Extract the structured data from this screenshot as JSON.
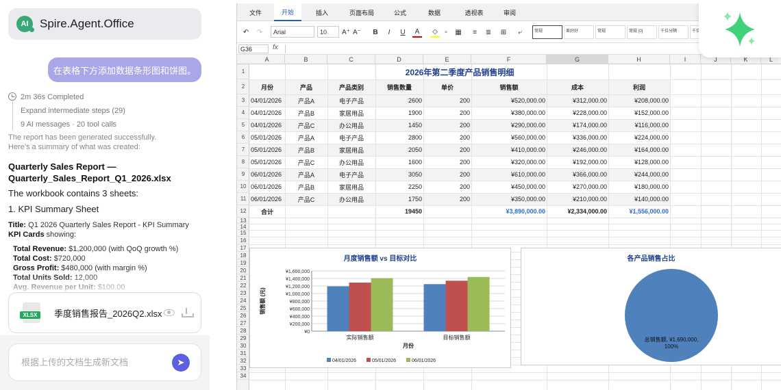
{
  "app": {
    "name": "Spire.Agent.Office",
    "logo_text": "AI"
  },
  "conversation": {
    "user_message": "在表格下方添加数据条形图和饼图。",
    "status": "2m 36s Completed",
    "steps": "Expand intermediate steps (29)",
    "messages": "9 AI messages · 20 tool calls",
    "summary_line1": "The report has been generated successfully.",
    "summary_line2": "Here's a summary of what was created:",
    "report_title": "Quarterly Sales Report — Quarterly_Sales_Report_Q1_2026.xlsx",
    "contains": "The workbook contains 3 sheets:",
    "sheet1": "1. KPI Summary Sheet",
    "title_label": "Title:",
    "title_value": "Q1 2026 Quarterly Sales Report - KPI Summary",
    "kpi_label": "KPI Cards",
    "kpi_suffix": "showing:",
    "kpis": [
      {
        "label": "Total Revenue:",
        "value": "$1,200,000 (with QoQ growth %)"
      },
      {
        "label": "Total Cost:",
        "value": "$720,000"
      },
      {
        "label": "Gross Profit:",
        "value": "$480,000 (with margin %)"
      },
      {
        "label": "Total Units Sold:",
        "value": "12,000"
      },
      {
        "label": "Avg. Revenue per Unit:",
        "value": "$100.00"
      }
    ]
  },
  "file": {
    "badge": "XLSX",
    "name": "季度销售报告_2026Q2.xlsx"
  },
  "input": {
    "placeholder": "根据上传的文档生成新文档"
  },
  "excel": {
    "menu_tabs": [
      "文件",
      "开始",
      "插入",
      "页面布局",
      "公式",
      "数据",
      "透视表",
      "审阅"
    ],
    "font": "Arial",
    "font_size": "10",
    "cell_ref": "G36",
    "fx": "fx",
    "styles": [
      "常规",
      "差好好",
      "常规",
      "常规 [0]",
      "千位分隔",
      "千位分隔"
    ],
    "columns": [
      "A",
      "B",
      "C",
      "D",
      "E",
      "F",
      "G",
      "H",
      "I",
      "J",
      "K",
      "L"
    ],
    "rows": [
      "1",
      "2",
      "3",
      "4",
      "5",
      "6",
      "7",
      "8",
      "9",
      "10",
      "11",
      "12",
      "13",
      "14",
      "15",
      "16",
      "17",
      "18",
      "19",
      "20",
      "21",
      "22",
      "23",
      "24",
      "25",
      "26",
      "27",
      "28",
      "29",
      "30",
      "31",
      "32",
      "33",
      "34"
    ],
    "table_title": "2026年第二季度产品销售明细",
    "headers": [
      "月份",
      "产品",
      "产品类别",
      "销售数量",
      "单价",
      "销售额",
      "成本",
      "利润"
    ],
    "data_rows": [
      [
        "04/01/2026",
        "产品A",
        "电子产品",
        "2600",
        "200",
        "¥520,000.00",
        "¥312,000.00",
        "¥208,000.00"
      ],
      [
        "04/01/2026",
        "产品B",
        "家居用品",
        "1900",
        "200",
        "¥380,000.00",
        "¥228,000.00",
        "¥152,000.00"
      ],
      [
        "04/01/2026",
        "产品C",
        "办公用品",
        "1450",
        "200",
        "¥290,000.00",
        "¥174,000.00",
        "¥116,000.00"
      ],
      [
        "05/01/2026",
        "产品A",
        "电子产品",
        "2800",
        "200",
        "¥560,000.00",
        "¥336,000.00",
        "¥224,000.00"
      ],
      [
        "05/01/2026",
        "产品B",
        "家居用品",
        "2050",
        "200",
        "¥410,000.00",
        "¥246,000.00",
        "¥164,000.00"
      ],
      [
        "05/01/2026",
        "产品C",
        "办公用品",
        "1600",
        "200",
        "¥320,000.00",
        "¥192,000.00",
        "¥128,000.00"
      ],
      [
        "06/01/2026",
        "产品A",
        "电子产品",
        "3050",
        "200",
        "¥610,000.00",
        "¥366,000.00",
        "¥244,000.00"
      ],
      [
        "06/01/2026",
        "产品B",
        "家居用品",
        "2250",
        "200",
        "¥450,000.00",
        "¥270,000.00",
        "¥180,000.00"
      ],
      [
        "06/01/2026",
        "产品C",
        "办公用品",
        "1750",
        "200",
        "¥350,000.00",
        "¥210,000.00",
        "¥140,000.00"
      ]
    ],
    "total_row": [
      "合计",
      "",
      "",
      "19450",
      "",
      "¥3,890,000.00",
      "¥2,334,000.00",
      "¥1,556,000.00"
    ]
  },
  "chart_data": [
    {
      "type": "bar",
      "title": "月度销售额 vs 目标对比",
      "xlabel": "月份",
      "ylabel": "销售额 (元)",
      "categories": [
        "实际销售额",
        "目标销售额"
      ],
      "series": [
        {
          "name": "04/01/2026",
          "color": "#4f81bd",
          "values": [
            1190000,
            1250000
          ]
        },
        {
          "name": "05/01/2026",
          "color": "#c0504d",
          "values": [
            1290000,
            1340000
          ]
        },
        {
          "name": "06/01/2026",
          "color": "#9bbb59",
          "values": [
            1410000,
            1440000
          ]
        }
      ],
      "ylim": [
        0,
        1600000
      ],
      "yticks": [
        "¥0",
        "¥200,000",
        "¥400,000",
        "¥600,000",
        "¥800,000",
        "¥1,000,000",
        "¥1,200,000",
        "¥1,400,000",
        "¥1,600,000"
      ],
      "legend": "bottom",
      "grid": true
    },
    {
      "type": "pie",
      "title": "各产品销售占比",
      "slices": [
        {
          "label": "总销售额, ¥1,690,000, 100%",
          "value": 100,
          "color": "#4f81bd"
        }
      ]
    }
  ]
}
